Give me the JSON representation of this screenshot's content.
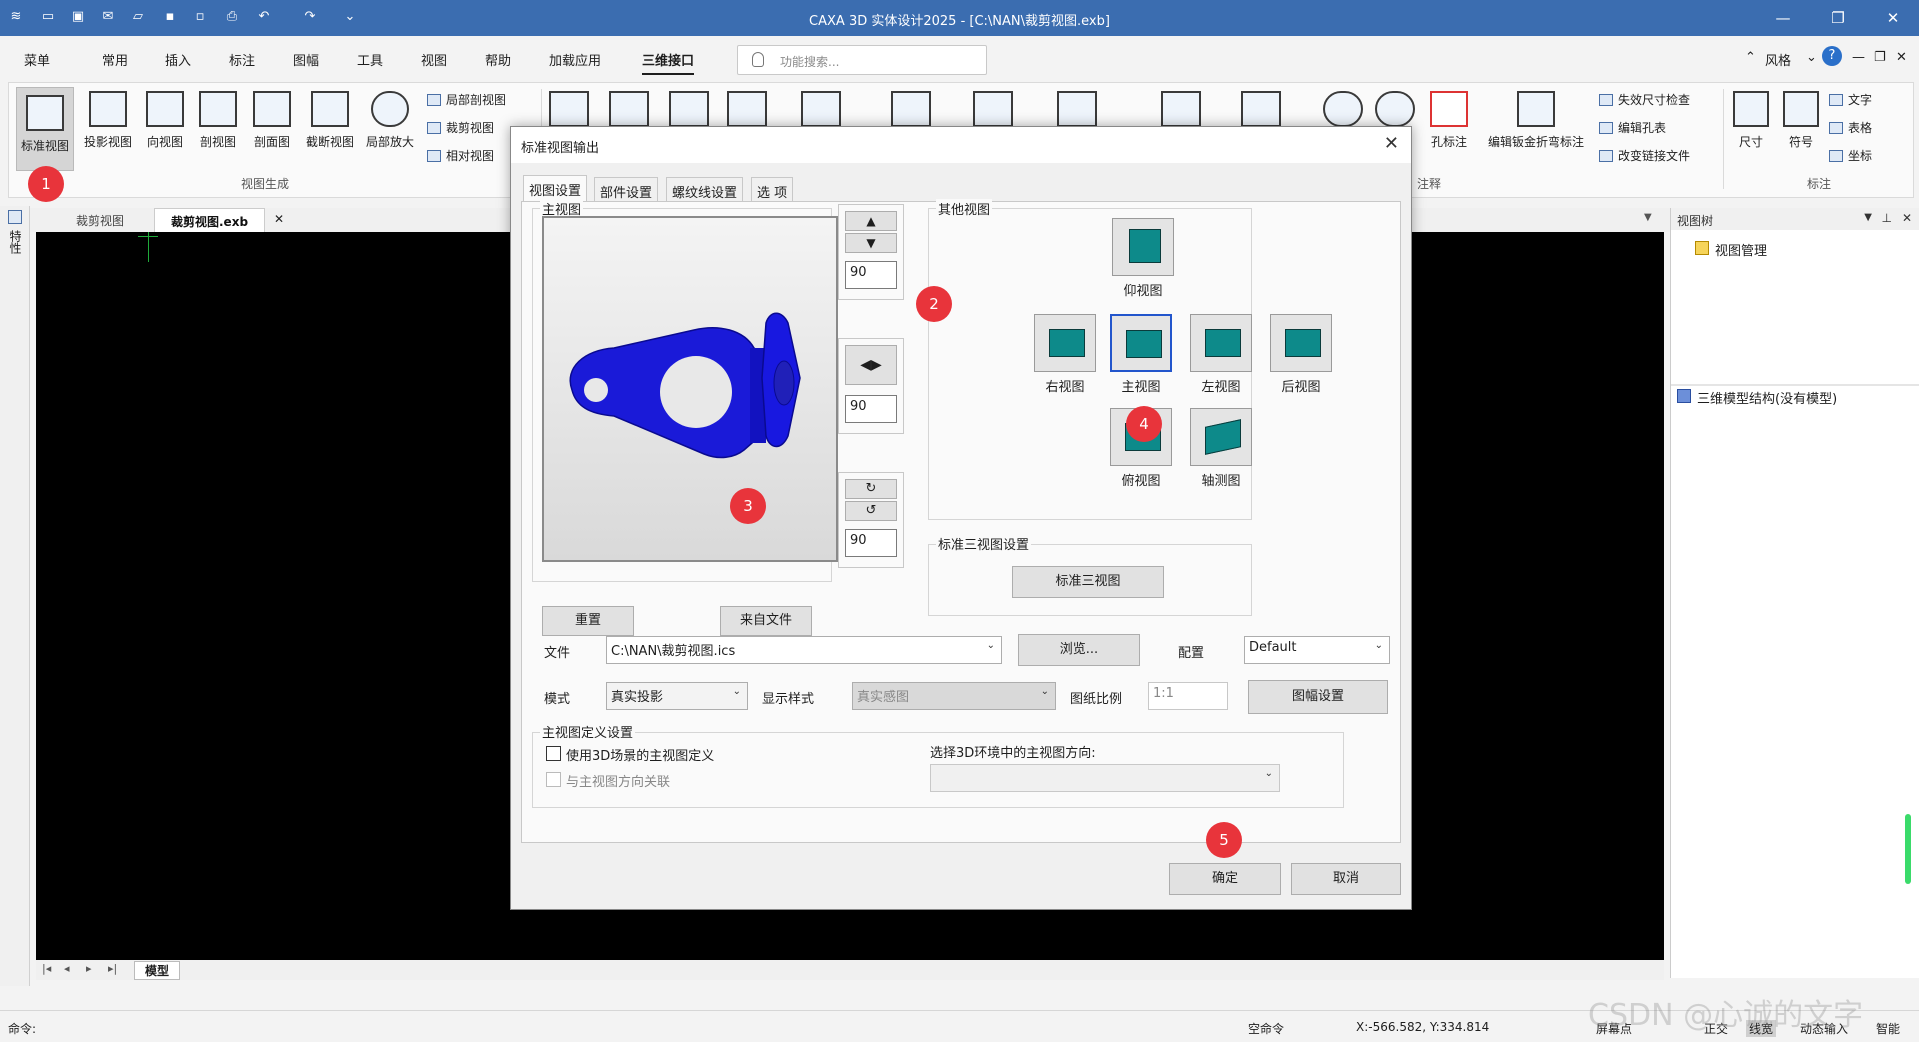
{
  "app": {
    "title": "CAXA 3D 实体设计2025 - [C:\\NAN\\裁剪视图.exb]"
  },
  "menu": {
    "items": [
      "菜单",
      "常用",
      "插入",
      "标注",
      "图幅",
      "工具",
      "视图",
      "帮助",
      "加载应用",
      "三维接口"
    ],
    "search_placeholder": "功能搜索...",
    "style_label": "风格"
  },
  "ribbon": {
    "big_buttons": [
      "标准视图",
      "投影视图",
      "向视图",
      "剖视图",
      "剖面图",
      "截断视图",
      "局部放大"
    ],
    "small_buttons": [
      "局部剖视图",
      "裁剪视图",
      "相对视图"
    ],
    "group_view_gen": "视图生成",
    "right_small": [
      "失效尺寸检查",
      "编辑孔表",
      "改变链接文件"
    ],
    "right_big": [
      "孔标注",
      "编辑钣金折弯标注"
    ],
    "group_annot": "注释",
    "group_mark": "标注",
    "mark_buttons": [
      "尺寸",
      "符号"
    ],
    "mark_small": [
      "文字",
      "表格",
      "坐标"
    ]
  },
  "doc_tabs": [
    "裁剪视图",
    "裁剪视图.exb"
  ],
  "left_strip": "特性",
  "right_panel": {
    "header": "视图树",
    "node1": "视图管理",
    "node2": "三维模型结构(没有模型)"
  },
  "bottom_tab": "模型",
  "status": {
    "command_label": "命令:",
    "empty_cmd": "空命令",
    "coords": "X:-566.582, Y:334.814",
    "items": [
      "屏幕点",
      "正交",
      "线宽",
      "动态输入",
      "智能"
    ]
  },
  "watermark": "CSDN @心诚的文字",
  "dialog": {
    "title": "标准视图输出",
    "tabs": [
      "视图设置",
      "部件设置",
      "螺纹线设置",
      "选 项"
    ],
    "main_view_label": "主视图",
    "reset_button": "重置",
    "from_file_button": "来自文件",
    "spin_values": [
      "90",
      "90",
      "90"
    ],
    "other_views_label": "其他视图",
    "views": {
      "bottom": "仰视图",
      "right": "右视图",
      "front": "主视图",
      "left": "左视图",
      "back": "后视图",
      "top": "俯视图",
      "iso": "轴测图"
    },
    "std3_group": "标准三视图设置",
    "std3_button": "标准三视图",
    "file_label": "文件",
    "file_value": "C:\\NAN\\裁剪视图.ics",
    "browse_button": "浏览...",
    "config_label": "配置",
    "config_value": "Default",
    "mode_label": "模式",
    "mode_value": "真实投影",
    "display_label": "显示样式",
    "display_value": "真实感图",
    "scale_label": "图纸比例",
    "scale_value": "1:1",
    "frame_button": "图幅设置",
    "def_group": "主视图定义设置",
    "use3d_label": "使用3D场景的主视图定义",
    "relate_label": "与主视图方向关联",
    "dir_label": "选择3D环境中的主视图方向:",
    "ok_button": "确定",
    "cancel_button": "取消"
  },
  "markers": [
    "1",
    "2",
    "3",
    "4",
    "5"
  ],
  "colors": {
    "titlebar": "#3b6db0",
    "marker": "#e8343b",
    "part": "#1a1ad8",
    "view_icon": "#0d8a8a"
  }
}
